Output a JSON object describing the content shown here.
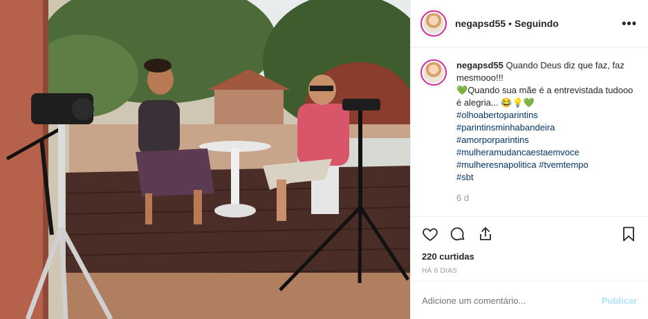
{
  "header": {
    "username": "negapsd55",
    "separator": "•",
    "follow_status": "Seguindo",
    "more_icon": "more-horizontal-icon"
  },
  "caption": {
    "username": "negapsd55",
    "text_line1": "Quando Deus diz que faz, faz mesmooo!!!",
    "text_line2": "Quando sua mãe é a entrevistada tudooo é alegria... 😂💡💚",
    "heart_icon": "💚",
    "hashtags": [
      "#olhoabertoparintins",
      "#parintinsminhabandeira",
      "#amorporparintins",
      "#mulheramudancaestaemvoce",
      "#mulheresnapolitica #tvemtempo",
      "#sbt"
    ],
    "time_ago": "6 d"
  },
  "actions": {
    "like_icon": "heart-outline-icon",
    "comment_icon": "comment-bubble-icon",
    "share_icon": "share-icon",
    "save_icon": "bookmark-icon",
    "likes": "220 curtidas",
    "posted": "HÁ 6 DIAS"
  },
  "comment": {
    "placeholder": "Adicione um comentário...",
    "publish_label": "Publicar"
  },
  "colors": {
    "link": "#003569",
    "muted": "#999999",
    "publish_disabled": "#b2dffc",
    "story_ring": "#d6249f"
  }
}
